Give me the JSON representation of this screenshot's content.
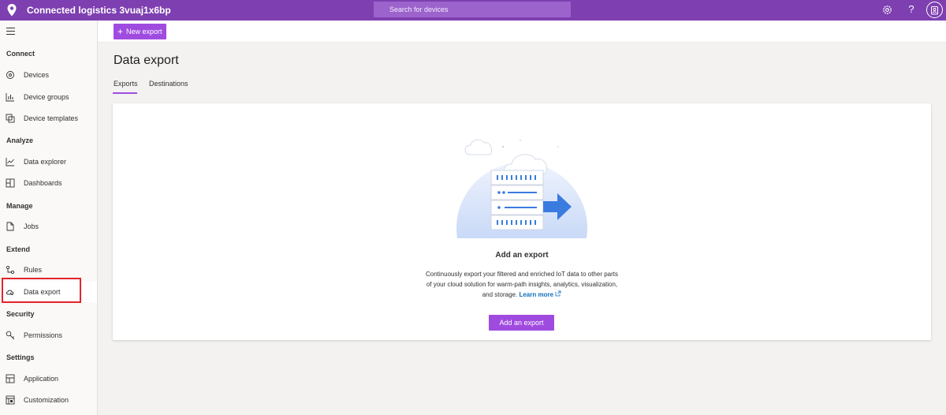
{
  "app": {
    "title": "Connected logistics 3vuaj1x6bp",
    "search_placeholder": "Search for devices",
    "help_label": "?"
  },
  "sidebar": {
    "sections": [
      {
        "label": "Connect"
      },
      {
        "label": "Analyze"
      },
      {
        "label": "Manage"
      },
      {
        "label": "Extend"
      },
      {
        "label": "Security"
      },
      {
        "label": "Settings"
      }
    ],
    "items": [
      {
        "label": "Devices",
        "icon": "devices-icon"
      },
      {
        "label": "Device groups",
        "icon": "device-groups-icon"
      },
      {
        "label": "Device templates",
        "icon": "device-templates-icon"
      },
      {
        "label": "Data explorer",
        "icon": "data-explorer-icon"
      },
      {
        "label": "Dashboards",
        "icon": "dashboards-icon"
      },
      {
        "label": "Jobs",
        "icon": "jobs-icon"
      },
      {
        "label": "Rules",
        "icon": "rules-icon"
      },
      {
        "label": "Data export",
        "icon": "data-export-icon",
        "active": true
      },
      {
        "label": "Permissions",
        "icon": "permissions-icon"
      },
      {
        "label": "Application",
        "icon": "application-icon"
      },
      {
        "label": "Customization",
        "icon": "customization-icon"
      }
    ]
  },
  "toolbar": {
    "new_export_label": "New export"
  },
  "page": {
    "title": "Data export",
    "tabs": [
      {
        "label": "Exports",
        "selected": true
      },
      {
        "label": "Destinations",
        "selected": false
      }
    ]
  },
  "empty_state": {
    "title": "Add an export",
    "description": "Continuously export your filtered and enriched IoT data to other parts of your cloud solution for warm-path insights, analytics, visualization, and storage.",
    "learn_more": "Learn more",
    "button_label": "Add an export"
  },
  "colors": {
    "header": "#7e3fb0",
    "accent": "#a04be0",
    "link": "#0f6cbd",
    "highlight_border": "#e3242b"
  }
}
